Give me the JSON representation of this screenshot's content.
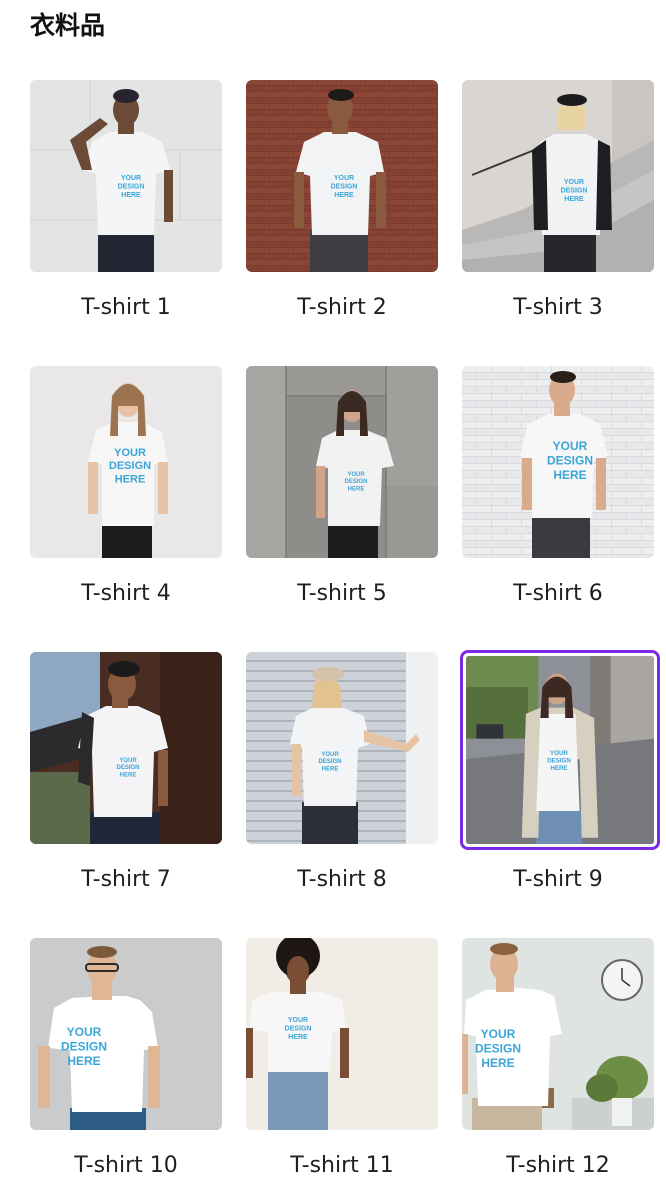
{
  "section": {
    "title": "衣料品"
  },
  "items": [
    {
      "label": "T-shirt 1",
      "print_text": "YOUR DESIGN HERE"
    },
    {
      "label": "T-shirt 2",
      "print_text": "YOUR DESIGN HERE"
    },
    {
      "label": "T-shirt 3",
      "print_text": "YOUR DESIGN HERE"
    },
    {
      "label": "T-shirt 4",
      "print_text": "YOUR DESIGN HERE"
    },
    {
      "label": "T-shirt 5",
      "print_text": "YOUR DESIGN HERE"
    },
    {
      "label": "T-shirt 6",
      "print_text": "YOUR DESIGN HERE"
    },
    {
      "label": "T-shirt 7",
      "print_text": "YOUR DESIGN HERE"
    },
    {
      "label": "T-shirt 8",
      "print_text": "YOUR DESIGN HERE"
    },
    {
      "label": "T-shirt 9",
      "print_text": "YOUR DESIGN HERE"
    },
    {
      "label": "T-shirt 10",
      "print_text": "YOUR DESIGN HERE"
    },
    {
      "label": "T-shirt 11",
      "print_text": "YOUR DESIGN HERE"
    },
    {
      "label": "T-shirt 12",
      "print_text": "YOUR DESIGN HERE"
    }
  ],
  "selected_item": "T-shirt 9",
  "colors": {
    "selection_border": "#7d2ae8",
    "print_text": "#3aa6d8"
  }
}
